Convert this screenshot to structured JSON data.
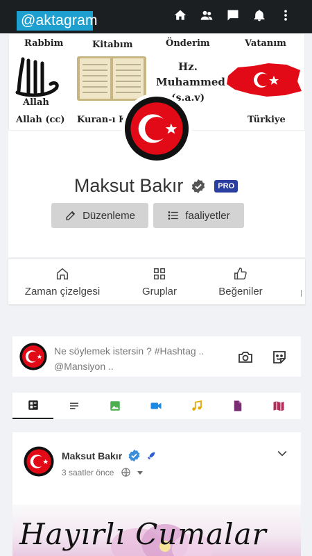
{
  "app": {
    "logo_text": "@aktagram"
  },
  "topbar": {
    "icons": [
      "home-icon",
      "friends-icon",
      "messages-icon",
      "notifications-icon",
      "more-vertical-icon"
    ]
  },
  "cover": {
    "labels": {
      "rabbim": "Rabbim",
      "kitabim": "Kitabım",
      "onderim": "Önderim",
      "vatanim": "Vatanım",
      "allah": "Allah",
      "allah_cc": "Allah (cc)",
      "kuran": "Kuran-ı Ke",
      "hz": "Hz.",
      "muhammed": "Muhammed",
      "sav": "(s.a.v)",
      "turkiye": "Türkiye"
    }
  },
  "profile": {
    "name": "Maksut Bakır",
    "badge": "PRO",
    "edit_label": "Düzenleme",
    "activities_label": "faaliyetler"
  },
  "profile_tabs": [
    {
      "label": "Zaman çizelgesi",
      "icon": "home-icon"
    },
    {
      "label": "Gruplar",
      "icon": "grid-icon"
    },
    {
      "label": "Beğeniler",
      "icon": "thumbs-up-icon"
    }
  ],
  "composer": {
    "placeholder": "Ne söylemek istersin ? #Hashtag .. @Mansiyon .."
  },
  "feed_tabs": [
    "all-posts-icon",
    "text-icon",
    "image-icon",
    "video-icon",
    "music-icon",
    "file-icon",
    "map-icon"
  ],
  "colors": {
    "topbar": "#1c1f21",
    "logo_bg": "#1da0d0",
    "pro_badge": "#2a3ea0",
    "flag_red": "#e30a17",
    "image_tab": "#4caf50",
    "video_tab": "#1e88e5",
    "music_tab": "#e0a800",
    "file_tab": "#7b2d73",
    "map_tab": "#b0305a"
  },
  "post": {
    "author": "Maksut Bakır",
    "time": "3 saatler önce",
    "image_text": "Hayırlı Cumalar"
  }
}
